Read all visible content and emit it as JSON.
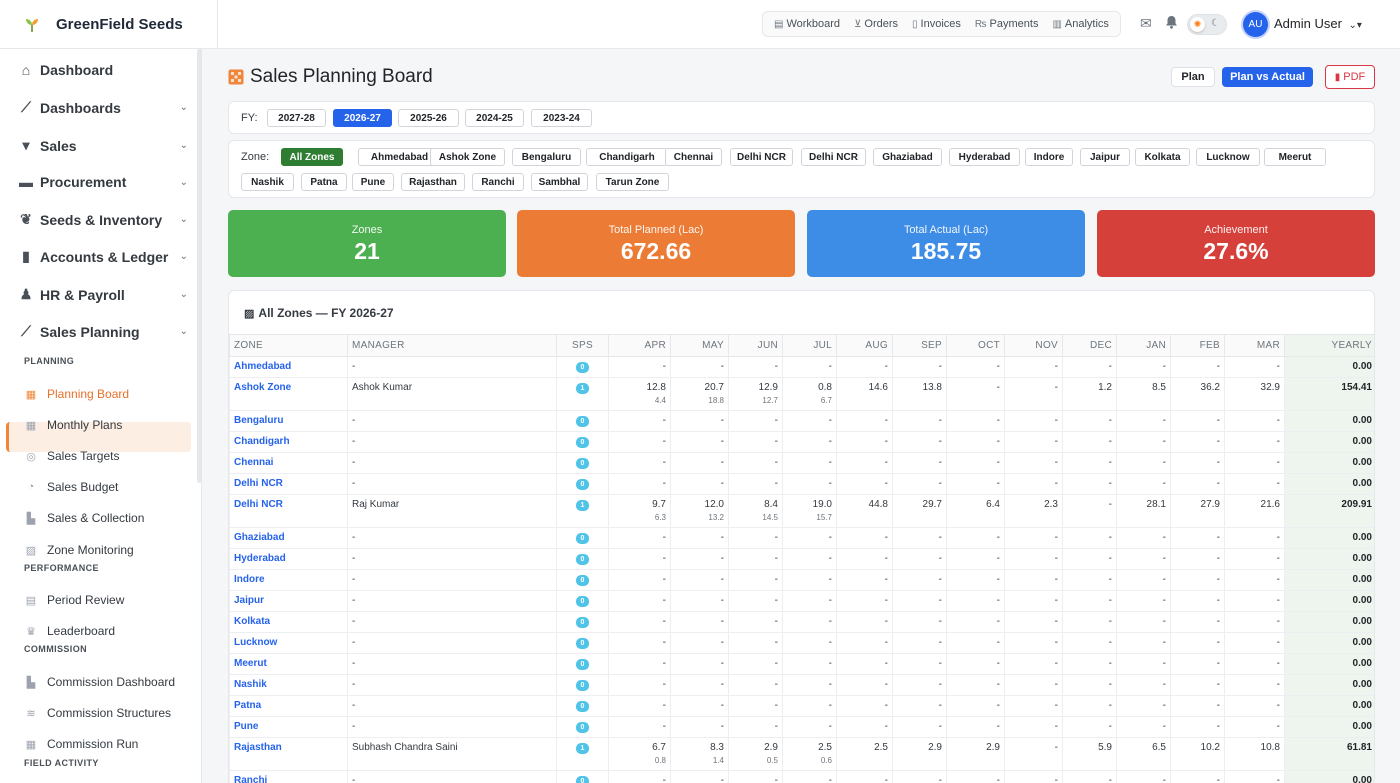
{
  "app": {
    "brand": "GreenField Seeds"
  },
  "topnav": [
    {
      "label": "Workboard",
      "icon": "clipboard-icon",
      "glyph": "▤"
    },
    {
      "label": "Orders",
      "icon": "cart-icon",
      "glyph": "⊻"
    },
    {
      "label": "Invoices",
      "icon": "file-icon",
      "glyph": "▯"
    },
    {
      "label": "Payments",
      "icon": "payment-icon",
      "glyph": "₨"
    },
    {
      "label": "Analytics",
      "icon": "chart-icon",
      "glyph": "▥"
    }
  ],
  "user": {
    "initials": "AU",
    "name": "Admin User"
  },
  "sidebar": {
    "main": [
      {
        "label": "Dashboard",
        "icon": "home-icon",
        "glyph": "⌂",
        "chevron": false
      },
      {
        "label": "Dashboards",
        "icon": "line-chart-icon",
        "glyph": "⟋",
        "chevron": true
      },
      {
        "label": "Sales",
        "icon": "cart-icon",
        "glyph": "▾",
        "chevron": true
      },
      {
        "label": "Procurement",
        "icon": "truck-icon",
        "glyph": "▬",
        "chevron": true
      },
      {
        "label": "Seeds & Inventory",
        "icon": "seedling-icon",
        "glyph": "❦",
        "chevron": true
      },
      {
        "label": "Accounts & Ledger",
        "icon": "book-icon",
        "glyph": "▮",
        "chevron": true
      },
      {
        "label": "HR & Payroll",
        "icon": "person-icon",
        "glyph": "♟",
        "chevron": true
      },
      {
        "label": "Sales Planning",
        "icon": "trend-icon",
        "glyph": "⟋",
        "chevron": true
      }
    ],
    "sections": [
      {
        "title": "PLANNING",
        "items": [
          {
            "label": "Planning Board",
            "icon": "grid-icon",
            "glyph": "▦",
            "active": true
          },
          {
            "label": "Monthly Plans",
            "icon": "calendar-icon",
            "glyph": "▦"
          },
          {
            "label": "Sales Targets",
            "icon": "target-icon",
            "glyph": "◎"
          },
          {
            "label": "Sales Budget",
            "icon": "pie-icon",
            "glyph": "◔"
          },
          {
            "label": "Sales & Collection",
            "icon": "chart-icon",
            "glyph": "▙"
          },
          {
            "label": "Zone Monitoring",
            "icon": "map-icon",
            "glyph": "▨"
          }
        ]
      },
      {
        "title": "PERFORMANCE",
        "items": [
          {
            "label": "Period Review",
            "icon": "clipboard-icon",
            "glyph": "▤"
          },
          {
            "label": "Leaderboard",
            "icon": "trophy-icon",
            "glyph": "♛"
          }
        ]
      },
      {
        "title": "COMMISSION",
        "items": [
          {
            "label": "Commission Dashboard",
            "icon": "chart-icon",
            "glyph": "▙"
          },
          {
            "label": "Commission Structures",
            "icon": "layers-icon",
            "glyph": "≋"
          },
          {
            "label": "Commission Run",
            "icon": "calculator-icon",
            "glyph": "▦"
          }
        ]
      },
      {
        "title": "FIELD ACTIVITY",
        "items": []
      }
    ]
  },
  "page": {
    "title": "Sales Planning Board",
    "buttons": {
      "plan": "Plan",
      "plan_vs_actual": "Plan vs Actual",
      "pdf": "PDF"
    },
    "fy_label": "FY:",
    "fy_options": [
      "2027-28",
      "2026-27",
      "2025-26",
      "2024-25",
      "2023-24"
    ],
    "fy_selected": "2026-27",
    "zone_label": "Zone:",
    "zone_options": [
      "All Zones",
      "Ahmedabad",
      "Ashok Zone",
      "Bengaluru",
      "Chandigarh",
      "Chennai",
      "Delhi NCR",
      "Delhi NCR",
      "Ghaziabad",
      "Hyderabad",
      "Indore",
      "Jaipur",
      "Kolkata",
      "Lucknow",
      "Meerut",
      "Nashik",
      "Patna",
      "Pune",
      "Rajasthan",
      "Ranchi",
      "Sambhal",
      "Tarun Zone"
    ],
    "zone_selected": "All Zones"
  },
  "stats": [
    {
      "label": "Zones",
      "value": "21",
      "color": "#4caf50"
    },
    {
      "label": "Total Planned (Lac)",
      "value": "672.66",
      "color": "#ec7c35"
    },
    {
      "label": "Total Actual (Lac)",
      "value": "185.75",
      "color": "#3d8ce6"
    },
    {
      "label": "Achievement",
      "value": "27.6%",
      "color": "#d6403a"
    }
  ],
  "table": {
    "title": "All Zones — FY 2026-27",
    "headers": [
      "ZONE",
      "MANAGER",
      "SPS",
      "APR",
      "MAY",
      "JUN",
      "JUL",
      "AUG",
      "SEP",
      "OCT",
      "NOV",
      "DEC",
      "JAN",
      "FEB",
      "MAR",
      "YEARLY"
    ],
    "rows": [
      {
        "zone": "Ahmedabad",
        "manager": "-",
        "sps": "0",
        "months": [
          "-",
          "-",
          "-",
          "-",
          "-",
          "-",
          "-",
          "-",
          "-",
          "-",
          "-",
          "-"
        ],
        "subs": null,
        "yearly": "0.00"
      },
      {
        "zone": "Ashok Zone",
        "manager": "Ashok Kumar",
        "sps": "1",
        "months": [
          "12.8",
          "20.7",
          "12.9",
          "0.8",
          "14.6",
          "13.8",
          "-",
          "-",
          "1.2",
          "8.5",
          "36.2",
          "32.9"
        ],
        "subs": [
          "4.4",
          "18.8",
          "12.7",
          "6.7",
          "",
          "",
          "",
          "",
          "",
          "",
          "",
          ""
        ],
        "yearly": "154.41"
      },
      {
        "zone": "Bengaluru",
        "manager": "-",
        "sps": "0",
        "months": [
          "-",
          "-",
          "-",
          "-",
          "-",
          "-",
          "-",
          "-",
          "-",
          "-",
          "-",
          "-"
        ],
        "subs": null,
        "yearly": "0.00"
      },
      {
        "zone": "Chandigarh",
        "manager": "-",
        "sps": "0",
        "months": [
          "-",
          "-",
          "-",
          "-",
          "-",
          "-",
          "-",
          "-",
          "-",
          "-",
          "-",
          "-"
        ],
        "subs": null,
        "yearly": "0.00"
      },
      {
        "zone": "Chennai",
        "manager": "-",
        "sps": "0",
        "months": [
          "-",
          "-",
          "-",
          "-",
          "-",
          "-",
          "-",
          "-",
          "-",
          "-",
          "-",
          "-"
        ],
        "subs": null,
        "yearly": "0.00"
      },
      {
        "zone": "Delhi NCR",
        "manager": "-",
        "sps": "0",
        "months": [
          "-",
          "-",
          "-",
          "-",
          "-",
          "-",
          "-",
          "-",
          "-",
          "-",
          "-",
          "-"
        ],
        "subs": null,
        "yearly": "0.00"
      },
      {
        "zone": "Delhi NCR",
        "manager": "Raj Kumar",
        "sps": "1",
        "months": [
          "9.7",
          "12.0",
          "8.4",
          "19.0",
          "44.8",
          "29.7",
          "6.4",
          "2.3",
          "-",
          "28.1",
          "27.9",
          "21.6"
        ],
        "subs": [
          "6.3",
          "13.2",
          "14.5",
          "15.7",
          "",
          "",
          "",
          "",
          "",
          "",
          "",
          ""
        ],
        "yearly": "209.91"
      },
      {
        "zone": "Ghaziabad",
        "manager": "-",
        "sps": "0",
        "months": [
          "-",
          "-",
          "-",
          "-",
          "-",
          "-",
          "-",
          "-",
          "-",
          "-",
          "-",
          "-"
        ],
        "subs": null,
        "yearly": "0.00"
      },
      {
        "zone": "Hyderabad",
        "manager": "-",
        "sps": "0",
        "months": [
          "-",
          "-",
          "-",
          "-",
          "-",
          "-",
          "-",
          "-",
          "-",
          "-",
          "-",
          "-"
        ],
        "subs": null,
        "yearly": "0.00"
      },
      {
        "zone": "Indore",
        "manager": "-",
        "sps": "0",
        "months": [
          "-",
          "-",
          "-",
          "-",
          "-",
          "-",
          "-",
          "-",
          "-",
          "-",
          "-",
          "-"
        ],
        "subs": null,
        "yearly": "0.00"
      },
      {
        "zone": "Jaipur",
        "manager": "-",
        "sps": "0",
        "months": [
          "-",
          "-",
          "-",
          "-",
          "-",
          "-",
          "-",
          "-",
          "-",
          "-",
          "-",
          "-"
        ],
        "subs": null,
        "yearly": "0.00"
      },
      {
        "zone": "Kolkata",
        "manager": "-",
        "sps": "0",
        "months": [
          "-",
          "-",
          "-",
          "-",
          "-",
          "-",
          "-",
          "-",
          "-",
          "-",
          "-",
          "-"
        ],
        "subs": null,
        "yearly": "0.00"
      },
      {
        "zone": "Lucknow",
        "manager": "-",
        "sps": "0",
        "months": [
          "-",
          "-",
          "-",
          "-",
          "-",
          "-",
          "-",
          "-",
          "-",
          "-",
          "-",
          "-"
        ],
        "subs": null,
        "yearly": "0.00"
      },
      {
        "zone": "Meerut",
        "manager": "-",
        "sps": "0",
        "months": [
          "-",
          "-",
          "-",
          "-",
          "-",
          "-",
          "-",
          "-",
          "-",
          "-",
          "-",
          "-"
        ],
        "subs": null,
        "yearly": "0.00"
      },
      {
        "zone": "Nashik",
        "manager": "-",
        "sps": "0",
        "months": [
          "-",
          "-",
          "-",
          "-",
          "-",
          "-",
          "-",
          "-",
          "-",
          "-",
          "-",
          "-"
        ],
        "subs": null,
        "yearly": "0.00"
      },
      {
        "zone": "Patna",
        "manager": "-",
        "sps": "0",
        "months": [
          "-",
          "-",
          "-",
          "-",
          "-",
          "-",
          "-",
          "-",
          "-",
          "-",
          "-",
          "-"
        ],
        "subs": null,
        "yearly": "0.00"
      },
      {
        "zone": "Pune",
        "manager": "-",
        "sps": "0",
        "months": [
          "-",
          "-",
          "-",
          "-",
          "-",
          "-",
          "-",
          "-",
          "-",
          "-",
          "-",
          "-"
        ],
        "subs": null,
        "yearly": "0.00"
      },
      {
        "zone": "Rajasthan",
        "manager": "Subhash Chandra Saini",
        "sps": "1",
        "months": [
          "6.7",
          "8.3",
          "2.9",
          "2.5",
          "2.5",
          "2.9",
          "2.9",
          "-",
          "5.9",
          "6.5",
          "10.2",
          "10.8"
        ],
        "subs": [
          "0.8",
          "1.4",
          "0.5",
          "0.6",
          "",
          "",
          "",
          "",
          "",
          "",
          "",
          ""
        ],
        "yearly": "61.81"
      },
      {
        "zone": "Ranchi",
        "manager": "-",
        "sps": "0",
        "months": [
          "-",
          "-",
          "-",
          "-",
          "-",
          "-",
          "-",
          "-",
          "-",
          "-",
          "-",
          "-"
        ],
        "subs": null,
        "yearly": "0.00"
      }
    ]
  }
}
